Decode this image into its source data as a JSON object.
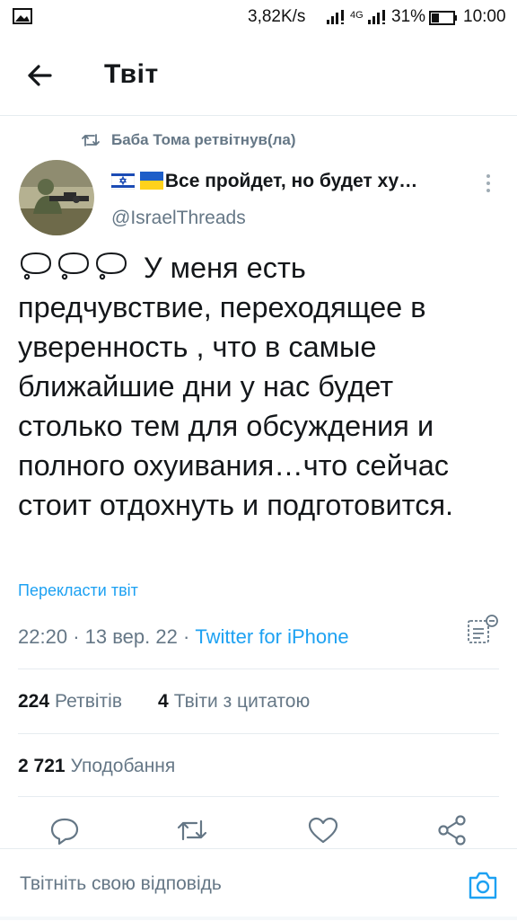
{
  "status_bar": {
    "speed": "3,82K/s",
    "network": "4G",
    "battery": "31%",
    "time": "10:00",
    "icons": [
      "image-icon",
      "signal-icon",
      "battery-icon"
    ]
  },
  "header": {
    "title": "Твіт",
    "back_icon": "arrow-left-icon"
  },
  "retweet": {
    "text": "Баба Тома ретвітнув(ла)"
  },
  "author": {
    "name": "Все пройдет, но будет ху…",
    "handle": "@IsraelThreads",
    "flags": [
      "israel-flag-icon",
      "ukraine-flag-icon"
    ]
  },
  "tweet": {
    "text": "У меня есть предчувствие, переходящее в уверенность , что в самые ближайшие дни у нас будет столько тем для обсуждения и полного охуивания…что сейчас стоит отдохнуть и подготовится.",
    "emoji_prefix": "thought-bubble-icon x3"
  },
  "translate_label": "Перекласти твіт",
  "meta": {
    "time": "22:20",
    "date": "13 вер. 22",
    "separator": "·",
    "source": "Twitter for iPhone"
  },
  "stats": {
    "retweets_count": "224",
    "retweets_label": "Ретвітів",
    "quotes_count": "4",
    "quotes_label": "Твіти з цитатою",
    "likes_count": "2 721",
    "likes_label": "Уподобання"
  },
  "actions": [
    "reply-icon",
    "retweet-icon",
    "like-icon",
    "share-icon"
  ],
  "reply": {
    "placeholder": "Твітніть свою відповідь",
    "camera_icon": "camera-icon"
  },
  "colors": {
    "accent": "#1da1f2",
    "secondary_text": "#657786",
    "primary_text": "#14171a",
    "separator": "#e6ecf0"
  }
}
